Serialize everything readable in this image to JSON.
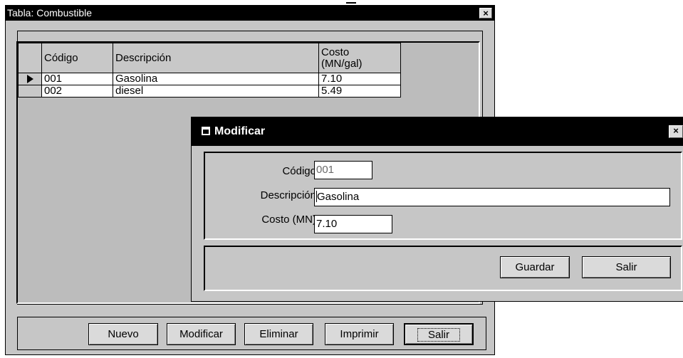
{
  "main_window": {
    "title": "Tabla: Combustible",
    "close_glyph": "×",
    "columns": [
      "Código",
      "Descripción",
      "Costo (MN/gal)"
    ],
    "rows": [
      {
        "codigo": "001",
        "descripcion": "Gasolina",
        "costo": "7.10",
        "current": true
      },
      {
        "codigo": "002",
        "descripcion": "diesel",
        "costo": "5.49",
        "current": false
      }
    ],
    "buttons": {
      "nuevo": "Nuevo",
      "modificar": "Modificar",
      "eliminar": "Eliminar",
      "imprimir": "Imprimir",
      "salir": "Salir"
    }
  },
  "dialog": {
    "title": "Modificar",
    "close_glyph": "×",
    "labels": {
      "codigo": "Código",
      "descripcion": "Descripción",
      "costo": "Costo (MN)"
    },
    "values": {
      "codigo": "001",
      "descripcion": "Gasolina",
      "costo": "7.10"
    },
    "buttons": {
      "guardar": "Guardar",
      "salir": "Salir"
    }
  }
}
